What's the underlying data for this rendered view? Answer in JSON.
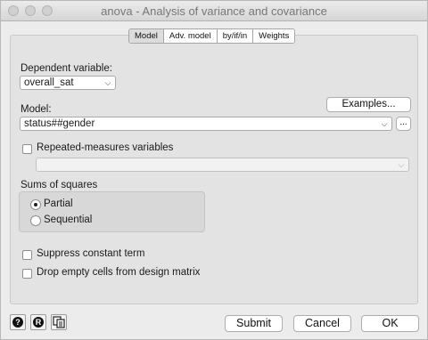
{
  "window": {
    "title": "anova - Analysis of variance and covariance"
  },
  "tabs": [
    {
      "label": "Model"
    },
    {
      "label": "Adv. model"
    },
    {
      "label": "by/if/in"
    },
    {
      "label": "Weights"
    }
  ],
  "dependent": {
    "label": "Dependent variable:",
    "value": "overall_sat"
  },
  "model": {
    "label": "Model:",
    "value": "status##gender",
    "examples_label": "Examples...",
    "browse_label": "..."
  },
  "repeated": {
    "label": "Repeated-measures variables",
    "value": ""
  },
  "sums": {
    "title": "Sums of squares",
    "options": [
      {
        "label": "Partial",
        "selected": true
      },
      {
        "label": "Sequential",
        "selected": false
      }
    ]
  },
  "options": {
    "suppress_constant": "Suppress constant term",
    "drop_empty": "Drop empty cells from design matrix"
  },
  "footer": {
    "submit": "Submit",
    "cancel": "Cancel",
    "ok": "OK",
    "help_glyph": "?",
    "reset_glyph": "R"
  }
}
